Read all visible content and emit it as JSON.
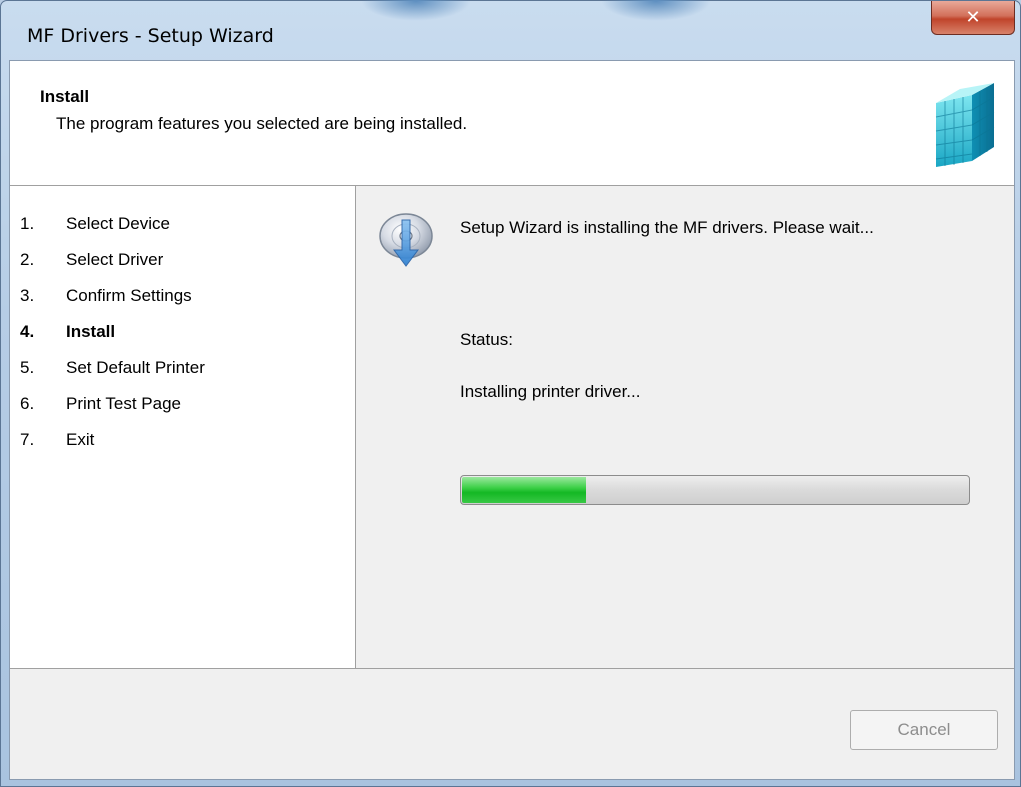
{
  "window": {
    "title": "MF Drivers - Setup Wizard",
    "close_icon": "close-icon"
  },
  "header": {
    "title": "Install",
    "subtitle": "The program features you selected are being installed.",
    "logo_icon": "cube-logo-icon"
  },
  "steps": [
    {
      "number": "1.",
      "label": "Select Device",
      "active": false
    },
    {
      "number": "2.",
      "label": "Select Driver",
      "active": false
    },
    {
      "number": "3.",
      "label": "Confirm Settings",
      "active": false
    },
    {
      "number": "4.",
      "label": "Install",
      "active": true
    },
    {
      "number": "5.",
      "label": "Set Default Printer",
      "active": false
    },
    {
      "number": "6.",
      "label": "Print Test Page",
      "active": false
    },
    {
      "number": "7.",
      "label": "Exit",
      "active": false
    }
  ],
  "main": {
    "message": "Setup Wizard is installing the MF drivers. Please wait...",
    "message_icon": "disc-install-icon",
    "status_label": "Status:",
    "status_text": "Installing printer driver...",
    "progress_fraction": 0.245,
    "progress_color": "#14b824"
  },
  "footer": {
    "cancel_label": "Cancel",
    "cancel_enabled": false
  }
}
